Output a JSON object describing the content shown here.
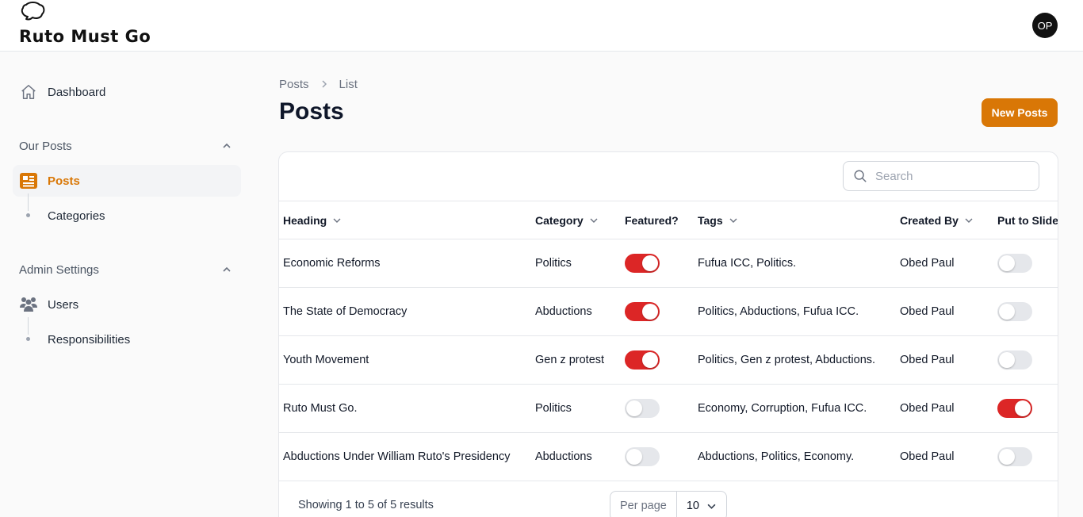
{
  "app": {
    "brand": "Ruto Must Go",
    "avatar_initials": "OP"
  },
  "sidebar": {
    "dashboard": "Dashboard",
    "group_posts": "Our Posts",
    "posts": "Posts",
    "categories": "Categories",
    "group_admin": "Admin Settings",
    "users": "Users",
    "responsibilities": "Responsibilities"
  },
  "breadcrumb": {
    "root": "Posts",
    "current": "List"
  },
  "page": {
    "title": "Posts",
    "new_button": "New Posts"
  },
  "search": {
    "placeholder": "Search"
  },
  "table": {
    "columns": {
      "heading": "Heading",
      "category": "Category",
      "featured": "Featured?",
      "tags": "Tags",
      "created_by": "Created By",
      "slide": "Put to Slide"
    },
    "rows": [
      {
        "heading": "Economic Reforms",
        "category": "Politics",
        "featured": true,
        "tags": "Fufua ICC, Politics.",
        "created_by": "Obed Paul",
        "slide": false
      },
      {
        "heading": "The State of Democracy",
        "category": "Abductions",
        "featured": true,
        "tags": "Politics, Abductions, Fufua ICC.",
        "created_by": "Obed Paul",
        "slide": false
      },
      {
        "heading": "Youth Movement",
        "category": "Gen z protest",
        "featured": true,
        "tags": "Politics, Gen z protest, Abductions.",
        "created_by": "Obed Paul",
        "slide": false
      },
      {
        "heading": "Ruto Must Go.",
        "category": "Politics",
        "featured": false,
        "tags": "Economy, Corruption, Fufua ICC.",
        "created_by": "Obed Paul",
        "slide": true
      },
      {
        "heading": "Abductions Under William Ruto's Presidency",
        "category": "Abductions",
        "featured": false,
        "tags": "Abductions, Politics, Economy.",
        "created_by": "Obed Paul",
        "slide": false
      }
    ]
  },
  "footer": {
    "summary": "Showing 1 to 5 of 5 results",
    "per_page_label": "Per page",
    "per_page_value": "10"
  },
  "colors": {
    "accent": "#d97706",
    "toggle_on": "#dc2626",
    "toggle_off": "#e5e7eb"
  }
}
